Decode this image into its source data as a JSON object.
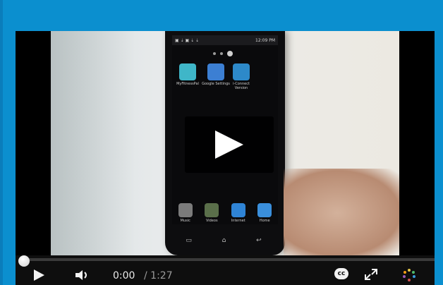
{
  "phone": {
    "status_time": "12:09 PM",
    "apps": [
      {
        "label": "MyFitnessPal",
        "color": "#3fb6c8"
      },
      {
        "label": "Google Settings",
        "color": "#3c7fd3"
      },
      {
        "label": "i-Connect Version",
        "color": "#2d89c9"
      }
    ],
    "dock": [
      {
        "label": "Music",
        "color": "#7b7b7b"
      },
      {
        "label": "Videos",
        "color": "#5a6f4a"
      },
      {
        "label": "Internet",
        "color": "#2f84d6"
      },
      {
        "label": "Home",
        "color": "#3a8fdc"
      }
    ]
  },
  "player": {
    "time_current": "0:00",
    "time_total": "/ 1:27",
    "progress_fraction": 0.0,
    "cc_label": "cc"
  },
  "colors": {
    "frame": "#0b8fcf",
    "accent_dots": "#e8c94a"
  }
}
